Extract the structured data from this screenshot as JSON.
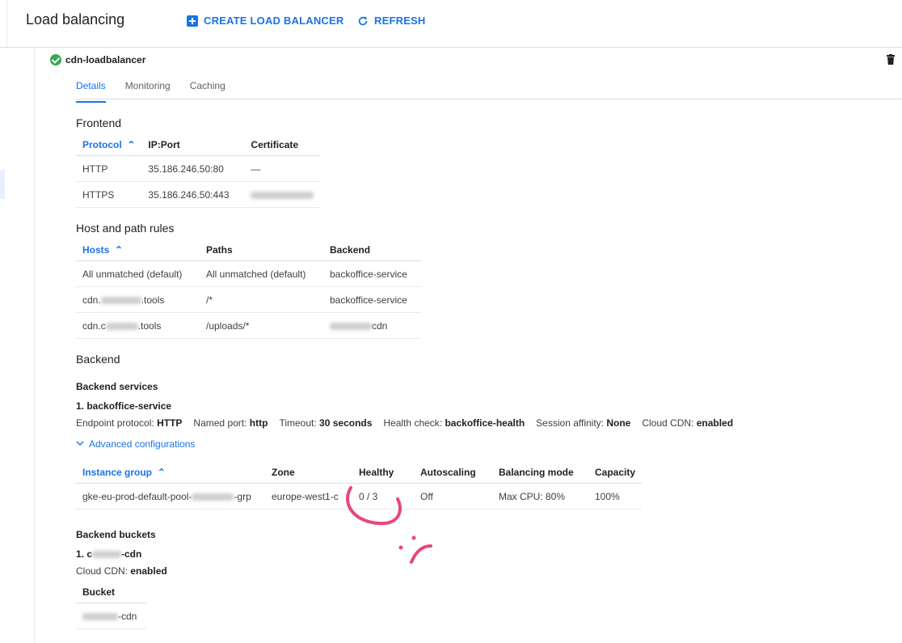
{
  "header": {
    "title": "Load balancing",
    "create_label": "CREATE LOAD BALANCER",
    "refresh_label": "REFRESH"
  },
  "lb": {
    "name": "cdn-loadbalancer",
    "status_icon": "check-circle-icon"
  },
  "tabs": [
    {
      "label": "Details",
      "active": true
    },
    {
      "label": "Monitoring",
      "active": false
    },
    {
      "label": "Caching",
      "active": false
    }
  ],
  "frontend": {
    "title": "Frontend",
    "columns": [
      "Protocol",
      "IP:Port",
      "Certificate"
    ],
    "rows": [
      [
        "HTTP",
        "35.186.246.50:80",
        "—"
      ],
      [
        "HTTPS",
        "35.186.246.50:443",
        ""
      ]
    ]
  },
  "host_rules": {
    "title": "Host and path rules",
    "columns": [
      "Hosts",
      "Paths",
      "Backend"
    ],
    "rows": [
      [
        "All unmatched (default)",
        "All unmatched (default)",
        "backoffice-service"
      ],
      [
        "cdn.",
        ".tools",
        "/*",
        "backoffice-service"
      ],
      [
        "cdn.c",
        ".tools",
        "/uploads/*",
        "cdn"
      ]
    ]
  },
  "backend": {
    "title": "Backend",
    "services_title": "Backend services",
    "service_name": "1. backoffice-service",
    "props": [
      {
        "label": "Endpoint protocol:",
        "value": "HTTP"
      },
      {
        "label": "Named port:",
        "value": "http"
      },
      {
        "label": "Timeout:",
        "value": "30 seconds"
      },
      {
        "label": "Health check:",
        "value": "backoffice-health"
      },
      {
        "label": "Session affinity:",
        "value": "None"
      },
      {
        "label": "Cloud CDN:",
        "value": "enabled"
      }
    ],
    "advanced_label": "Advanced configurations",
    "ig_columns": [
      "Instance group",
      "Zone",
      "Healthy",
      "Autoscaling",
      "Balancing mode",
      "Capacity"
    ],
    "ig_row": {
      "group_prefix": "gke-eu-prod-default-pool-",
      "group_suffix": "-grp",
      "zone": "europe-west1-c",
      "healthy": "0 / 3",
      "autoscaling": "Off",
      "mode": "Max CPU: 80%",
      "capacity": "100%"
    },
    "buckets_title": "Backend buckets",
    "bucket_name_prefix": "1. c",
    "bucket_name_suffix": "-cdn",
    "bucket_cdn_label": "Cloud CDN:",
    "bucket_cdn_value": "enabled",
    "bucket_column": "Bucket",
    "bucket_suffix": "-cdn"
  },
  "colors": {
    "accent": "#1a73e8",
    "success": "#34a853",
    "annotation": "#e8467c"
  }
}
